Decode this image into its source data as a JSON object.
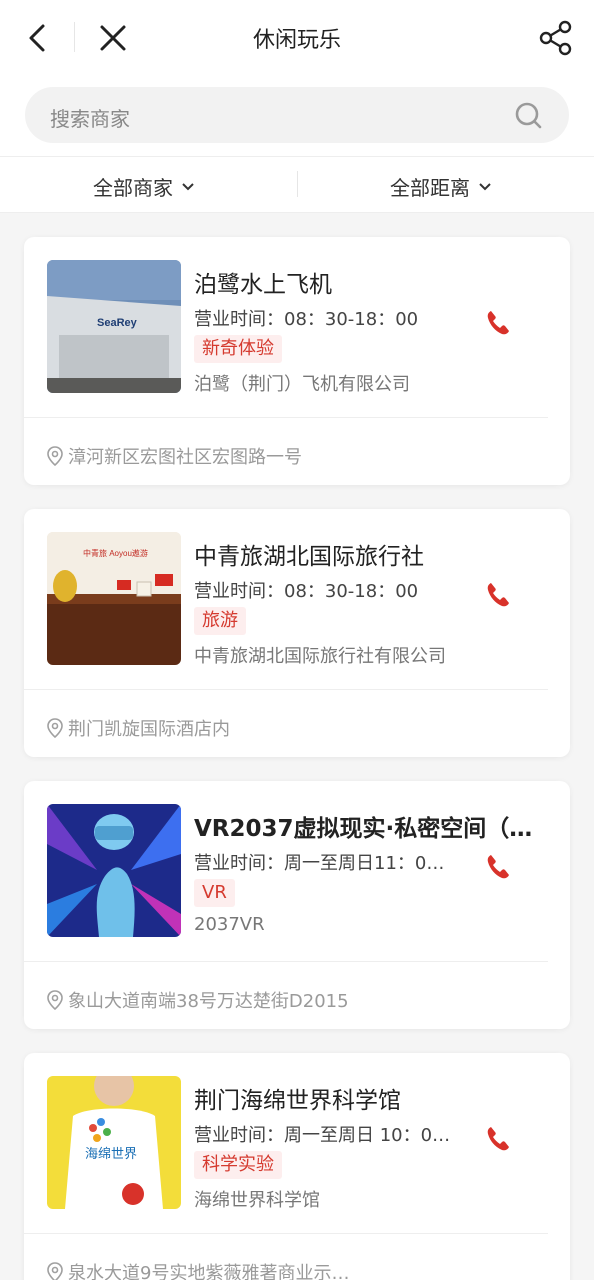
{
  "header": {
    "title": "休闲玩乐"
  },
  "search": {
    "placeholder": "搜索商家"
  },
  "filters": [
    {
      "label": "全部商家"
    },
    {
      "label": "全部距离"
    }
  ],
  "merchants": [
    {
      "name": "泊鹭水上飞机",
      "hours": "营业时间：08：30-18：00",
      "tag": "新奇体验",
      "company": "泊鹭（荆门）飞机有限公司",
      "address": "漳河新区宏图社区宏图路一号",
      "thumb_text": "SeaRey"
    },
    {
      "name": "中青旅湖北国际旅行社",
      "hours": "营业时间：08：30-18：00",
      "tag": "旅游",
      "company": "中青旅湖北国际旅行社有限公司",
      "address": "荆门凯旋国际酒店内",
      "thumb_text": "中青旅 Aoyou遨游"
    },
    {
      "name": "VR2037虚拟现实·私密空间（…",
      "hours": "营业时间：周一至周日11：00…",
      "tag": "VR",
      "company": "2037VR",
      "address": "象山大道南端38号万达楚街D2015"
    },
    {
      "name": "荆门海绵世界科学馆",
      "hours": "营业时间：周一至周日 10：0…",
      "tag": "科学实验",
      "company": "海绵世界科学馆",
      "address": "泉水大道9号实地紫薇雅著商业示…",
      "thumb_text": "海绵世界"
    }
  ],
  "colors": {
    "accent": "#d53a2f",
    "tag_bg": "#fdeeee"
  }
}
